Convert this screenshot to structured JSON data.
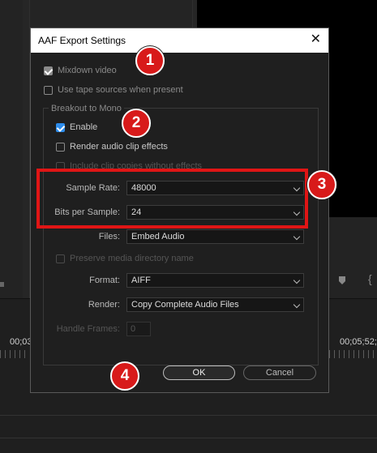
{
  "background": {
    "timecode_left": "00;03",
    "timecode_right": "00;05;52;"
  },
  "dialog": {
    "title": "AAF Export Settings",
    "close_glyph": "✕",
    "mixdown_video": {
      "label": "Mixdown video",
      "checked": true
    },
    "use_tape_sources": {
      "label": "Use tape sources when present",
      "checked": false
    },
    "breakout_group_title": "Breakout to Mono",
    "enable": {
      "label": "Enable",
      "checked": true
    },
    "render_audio_clip_effects": {
      "label": "Render audio clip effects",
      "checked": false
    },
    "include_clip_copies": {
      "label": "Include clip copies without effects",
      "checked": false
    },
    "sample_rate": {
      "label": "Sample Rate:",
      "value": "48000"
    },
    "bits_per_sample": {
      "label": "Bits per Sample:",
      "value": "24"
    },
    "files": {
      "label": "Files:",
      "value": "Embed Audio"
    },
    "preserve_media_dir": {
      "label": "Preserve media directory name",
      "checked": false
    },
    "format": {
      "label": "Format:",
      "value": "AIFF"
    },
    "render": {
      "label": "Render:",
      "value": "Copy Complete Audio Files"
    },
    "handle_frames": {
      "label": "Handle Frames:",
      "value": "0"
    },
    "ok_label": "OK",
    "cancel_label": "Cancel"
  },
  "annotations": {
    "badge_1": "1",
    "badge_2": "2",
    "badge_3": "3",
    "badge_4": "4",
    "badge_color": "#d81a1a",
    "highlight_color": "#e01515"
  }
}
